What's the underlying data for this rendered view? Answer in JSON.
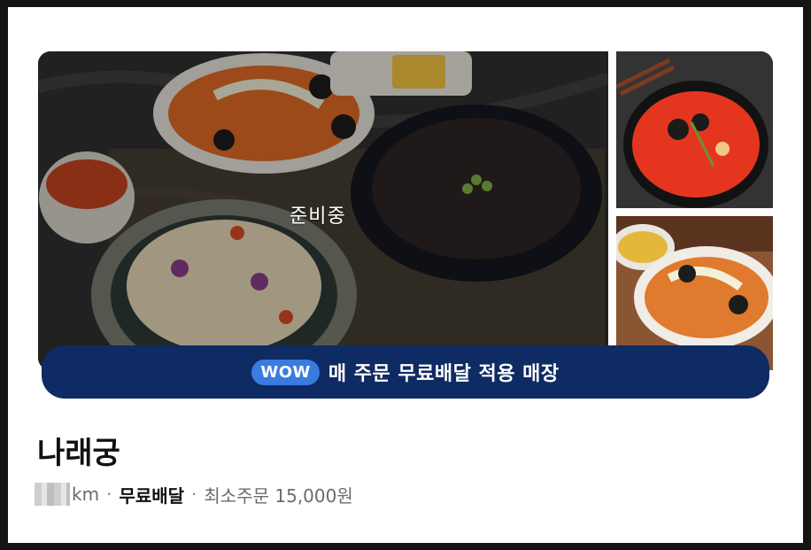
{
  "status": "준비중",
  "banner": {
    "badge": "WOW",
    "text": "매 주문 무료배달 적용 매장"
  },
  "store": {
    "name": "나래궁",
    "distance_unit": "km",
    "separator": "·",
    "delivery": "무료배달",
    "min_order": "최소주문 15,000원"
  },
  "colors": {
    "banner_bg": "#0f2b63",
    "badge_bg": "#3a7be0",
    "text_primary": "#111111",
    "text_secondary": "#6b6b6b"
  }
}
